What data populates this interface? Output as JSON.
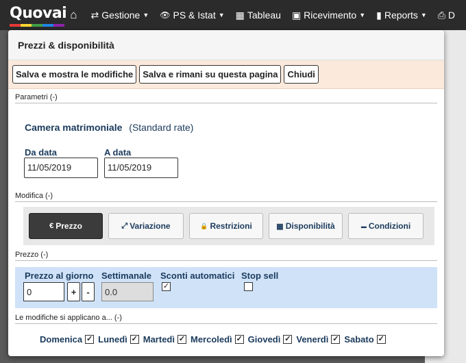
{
  "navbar": {
    "logo": "Quovai",
    "logo_colors": [
      "#e53935",
      "#fdd835",
      "#43a047",
      "#1e88e5",
      "#8e24aa"
    ],
    "items": [
      {
        "label": "Gestione",
        "icon": "swap-icon",
        "glyph": "⇄",
        "has_caret": true
      },
      {
        "label": "PS & Istat",
        "icon": "eye-icon",
        "glyph": "👁",
        "has_caret": true
      },
      {
        "label": "Tableau",
        "icon": "calendar-icon",
        "glyph": "▦",
        "has_caret": false
      },
      {
        "label": "Ricevimento",
        "icon": "briefcase-icon",
        "glyph": "▣",
        "has_caret": true
      },
      {
        "label": "Reports",
        "icon": "bar-chart-icon",
        "glyph": "▮",
        "has_caret": true
      }
    ],
    "home_glyph": "⌂",
    "truncated_glyph": "⎙ D"
  },
  "modal": {
    "title": "Prezzi & disponibilità",
    "toolbar": {
      "save_show": "Salva e mostra le modifiche",
      "save_stay": "Salva e rimani su questa pagina",
      "close": "Chiudi"
    },
    "parametri_label": "Parametri (-)",
    "room_name": "Camera matrimoniale",
    "rate_name": "(Standard rate)",
    "from_label": "Da data",
    "from_value": "11/05/2019",
    "to_label": "A data",
    "to_value": "11/05/2019",
    "modifica_label": "Modifica (-)",
    "tabs": [
      {
        "label": "Prezzo",
        "icon": "euro-icon",
        "glyph": "€",
        "active": true
      },
      {
        "label": "Variazione",
        "icon": "resize-icon",
        "glyph": "⤢",
        "active": false
      },
      {
        "label": "Restrizioni",
        "icon": "lock-icon",
        "glyph": "🔒",
        "active": false
      },
      {
        "label": "Disponibilità",
        "icon": "calendar-icon",
        "glyph": "▦",
        "active": false
      },
      {
        "label": "Condizioni",
        "icon": "comment-icon",
        "glyph": "▬",
        "active": false
      }
    ],
    "prezzo_label": "Prezzo (-)",
    "price_per_day_label": "Prezzo al giorno",
    "price_per_day_value": "0",
    "plus": "+",
    "minus": "-",
    "weekly_label": "Settimanale",
    "weekly_value": "0.0",
    "auto_discount_label": "Sconti automatici",
    "auto_discount_checked": true,
    "stop_sell_label": "Stop sell",
    "stop_sell_checked": false,
    "applies_label": "Le modifiche si applicano a... (-)",
    "days": [
      {
        "label": "Domenica",
        "checked": true
      },
      {
        "label": "Lunedì",
        "checked": true
      },
      {
        "label": "Martedì",
        "checked": true
      },
      {
        "label": "Mercoledì",
        "checked": true
      },
      {
        "label": "Giovedì",
        "checked": true
      },
      {
        "label": "Venerdì",
        "checked": true
      },
      {
        "label": "Sabato",
        "checked": true
      }
    ]
  }
}
